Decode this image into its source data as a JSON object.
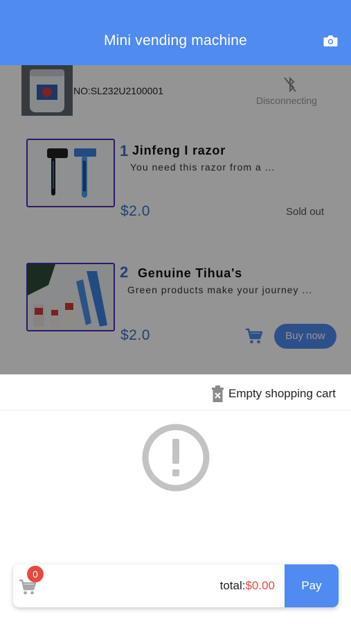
{
  "app_bar": {
    "title": "Mini vending machine",
    "camera_icon": "camera-icon"
  },
  "device": {
    "number": "NO:SL232U2100001",
    "status": "Disconnecting",
    "status_icon": "bluetooth-disabled-icon"
  },
  "products": [
    {
      "index": "1",
      "name": "Jinfeng I razor",
      "description": "You need this razor from a ...",
      "price": "$2.0",
      "status": "Sold out"
    },
    {
      "index": "2",
      "name": "Genuine Tihua's",
      "description": "Green products make your journey ...",
      "price": "$2.0",
      "buy_label": "Buy now"
    }
  ],
  "cart": {
    "empty_label": "Empty shopping cart",
    "badge_count": "0",
    "total_label": "total:",
    "total_value": "$0.00",
    "pay_label": "Pay",
    "empty_state_icon": "alert-circle-icon"
  },
  "colors": {
    "primary": "#4f8bf0",
    "accent_red": "#e64a3e",
    "price_blue": "#3a72c8"
  }
}
